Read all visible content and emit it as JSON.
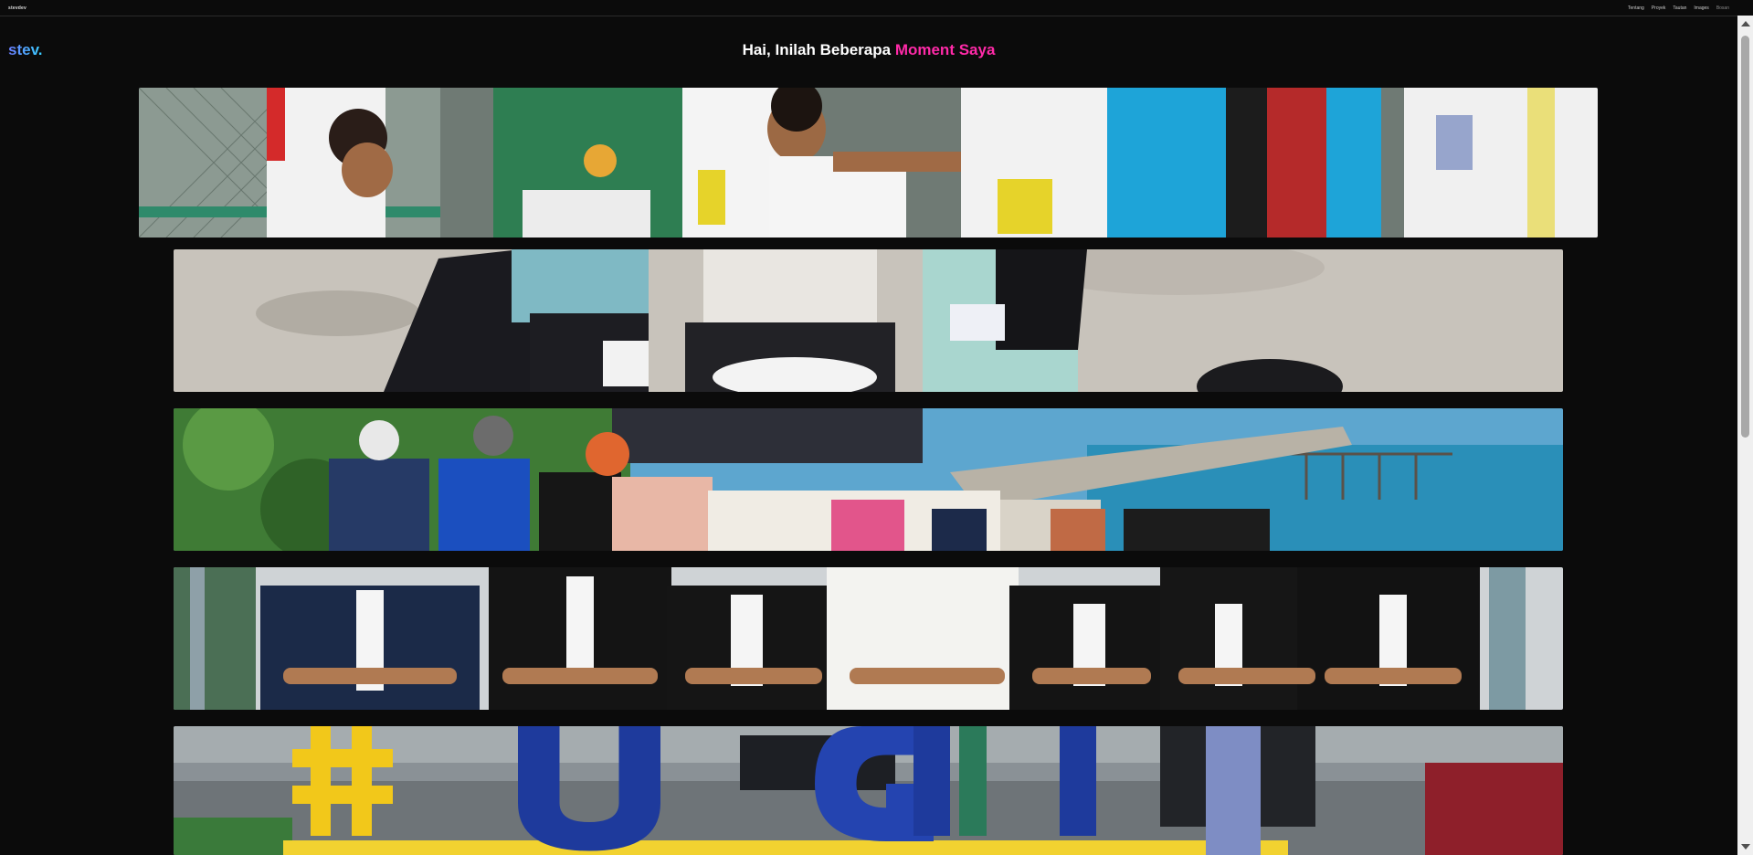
{
  "topbar": {
    "brand": "stevdev",
    "nav": [
      "Tentang",
      "Proyek",
      "Tautan",
      "Images",
      "Bosan"
    ]
  },
  "logo": "stev.",
  "heading": {
    "prefix": "Hai, Inilah Beberapa",
    "accent": "Moment Saya"
  },
  "moments": [
    "basketball-team-photo",
    "card-game-photo",
    "beach-group-photo",
    "formal-suits-group-photo",
    "ugm-sign-photo"
  ],
  "colors": {
    "background": "#0b0b0b",
    "accent": "#ff2aa8",
    "logo_gradient_start": "#6b7cff",
    "logo_gradient_end": "#36d0ff"
  }
}
